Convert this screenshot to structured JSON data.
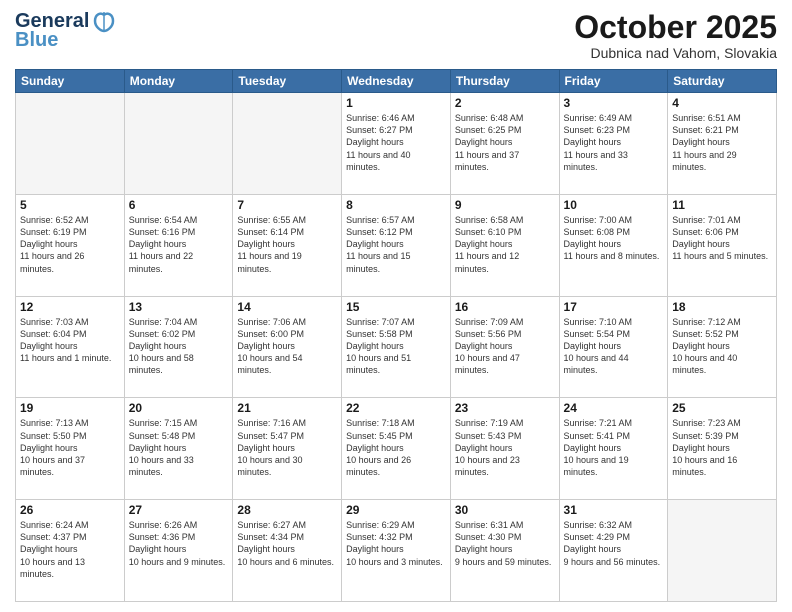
{
  "header": {
    "logo_general": "General",
    "logo_blue": "Blue",
    "month_title": "October 2025",
    "location": "Dubnica nad Vahom, Slovakia"
  },
  "days_of_week": [
    "Sunday",
    "Monday",
    "Tuesday",
    "Wednesday",
    "Thursday",
    "Friday",
    "Saturday"
  ],
  "weeks": [
    [
      {
        "day": "",
        "empty": true
      },
      {
        "day": "",
        "empty": true
      },
      {
        "day": "",
        "empty": true
      },
      {
        "day": "1",
        "sunrise": "6:46 AM",
        "sunset": "6:27 PM",
        "daylight": "11 hours and 40 minutes."
      },
      {
        "day": "2",
        "sunrise": "6:48 AM",
        "sunset": "6:25 PM",
        "daylight": "11 hours and 37 minutes."
      },
      {
        "day": "3",
        "sunrise": "6:49 AM",
        "sunset": "6:23 PM",
        "daylight": "11 hours and 33 minutes."
      },
      {
        "day": "4",
        "sunrise": "6:51 AM",
        "sunset": "6:21 PM",
        "daylight": "11 hours and 29 minutes."
      }
    ],
    [
      {
        "day": "5",
        "sunrise": "6:52 AM",
        "sunset": "6:19 PM",
        "daylight": "11 hours and 26 minutes."
      },
      {
        "day": "6",
        "sunrise": "6:54 AM",
        "sunset": "6:16 PM",
        "daylight": "11 hours and 22 minutes."
      },
      {
        "day": "7",
        "sunrise": "6:55 AM",
        "sunset": "6:14 PM",
        "daylight": "11 hours and 19 minutes."
      },
      {
        "day": "8",
        "sunrise": "6:57 AM",
        "sunset": "6:12 PM",
        "daylight": "11 hours and 15 minutes."
      },
      {
        "day": "9",
        "sunrise": "6:58 AM",
        "sunset": "6:10 PM",
        "daylight": "11 hours and 12 minutes."
      },
      {
        "day": "10",
        "sunrise": "7:00 AM",
        "sunset": "6:08 PM",
        "daylight": "11 hours and 8 minutes."
      },
      {
        "day": "11",
        "sunrise": "7:01 AM",
        "sunset": "6:06 PM",
        "daylight": "11 hours and 5 minutes."
      }
    ],
    [
      {
        "day": "12",
        "sunrise": "7:03 AM",
        "sunset": "6:04 PM",
        "daylight": "11 hours and 1 minute."
      },
      {
        "day": "13",
        "sunrise": "7:04 AM",
        "sunset": "6:02 PM",
        "daylight": "10 hours and 58 minutes."
      },
      {
        "day": "14",
        "sunrise": "7:06 AM",
        "sunset": "6:00 PM",
        "daylight": "10 hours and 54 minutes."
      },
      {
        "day": "15",
        "sunrise": "7:07 AM",
        "sunset": "5:58 PM",
        "daylight": "10 hours and 51 minutes."
      },
      {
        "day": "16",
        "sunrise": "7:09 AM",
        "sunset": "5:56 PM",
        "daylight": "10 hours and 47 minutes."
      },
      {
        "day": "17",
        "sunrise": "7:10 AM",
        "sunset": "5:54 PM",
        "daylight": "10 hours and 44 minutes."
      },
      {
        "day": "18",
        "sunrise": "7:12 AM",
        "sunset": "5:52 PM",
        "daylight": "10 hours and 40 minutes."
      }
    ],
    [
      {
        "day": "19",
        "sunrise": "7:13 AM",
        "sunset": "5:50 PM",
        "daylight": "10 hours and 37 minutes."
      },
      {
        "day": "20",
        "sunrise": "7:15 AM",
        "sunset": "5:48 PM",
        "daylight": "10 hours and 33 minutes."
      },
      {
        "day": "21",
        "sunrise": "7:16 AM",
        "sunset": "5:47 PM",
        "daylight": "10 hours and 30 minutes."
      },
      {
        "day": "22",
        "sunrise": "7:18 AM",
        "sunset": "5:45 PM",
        "daylight": "10 hours and 26 minutes."
      },
      {
        "day": "23",
        "sunrise": "7:19 AM",
        "sunset": "5:43 PM",
        "daylight": "10 hours and 23 minutes."
      },
      {
        "day": "24",
        "sunrise": "7:21 AM",
        "sunset": "5:41 PM",
        "daylight": "10 hours and 19 minutes."
      },
      {
        "day": "25",
        "sunrise": "7:23 AM",
        "sunset": "5:39 PM",
        "daylight": "10 hours and 16 minutes."
      }
    ],
    [
      {
        "day": "26",
        "sunrise": "6:24 AM",
        "sunset": "4:37 PM",
        "daylight": "10 hours and 13 minutes."
      },
      {
        "day": "27",
        "sunrise": "6:26 AM",
        "sunset": "4:36 PM",
        "daylight": "10 hours and 9 minutes."
      },
      {
        "day": "28",
        "sunrise": "6:27 AM",
        "sunset": "4:34 PM",
        "daylight": "10 hours and 6 minutes."
      },
      {
        "day": "29",
        "sunrise": "6:29 AM",
        "sunset": "4:32 PM",
        "daylight": "10 hours and 3 minutes."
      },
      {
        "day": "30",
        "sunrise": "6:31 AM",
        "sunset": "4:30 PM",
        "daylight": "9 hours and 59 minutes."
      },
      {
        "day": "31",
        "sunrise": "6:32 AM",
        "sunset": "4:29 PM",
        "daylight": "9 hours and 56 minutes."
      },
      {
        "day": "",
        "empty": true
      }
    ]
  ]
}
